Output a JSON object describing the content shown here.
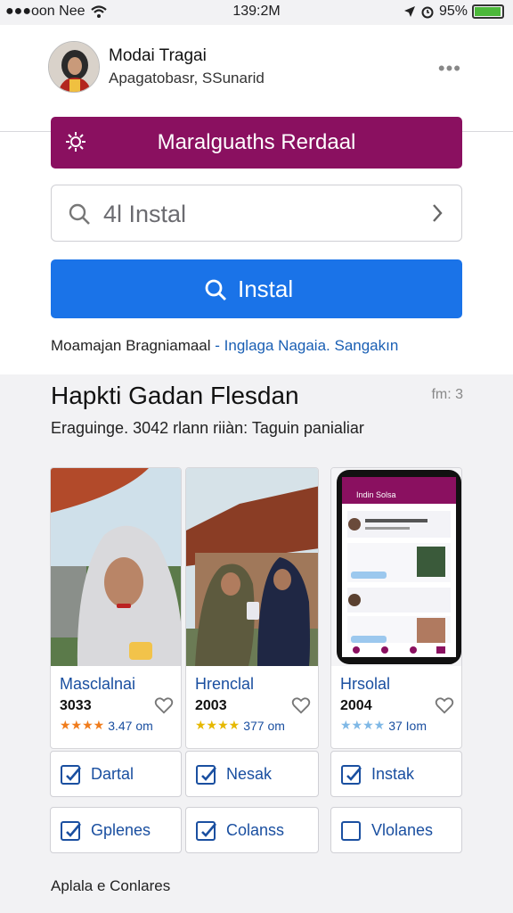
{
  "status_bar": {
    "carrier": "●●●oon Nee",
    "time": "139:2M",
    "battery": "95%",
    "battery_level": 0.95
  },
  "profile": {
    "name": "Modai Tragai",
    "subtitle": "Apagatobasr, SSunarid"
  },
  "banner": {
    "label": "Maralguaths Rerdaal"
  },
  "search": {
    "value": "4l Instal"
  },
  "install_button": {
    "label": "Instal"
  },
  "breadcrumb": {
    "main": "Mоamajan Bragniamaal",
    "link": "- Inglaga Nagaia. Sangakın"
  },
  "section": {
    "title": "Hapkti Gadan Flesdan",
    "count": "fm: 3",
    "subtitle": "Eraguinge. 3042 rlann riiàn: Taguin panialiar"
  },
  "cards": [
    {
      "title": "Masclalnai",
      "year": "3033",
      "rating": "3.47 om",
      "star_color": "#f07c1c"
    },
    {
      "title": "Hrenclal",
      "year": "2003",
      "rating": "377 om",
      "star_color": "#e6b800"
    },
    {
      "title": "Hrsolal",
      "year": "2004",
      "rating": "37 Iom",
      "star_color": "#7fb8e6"
    }
  ],
  "phone_screen": {
    "header": "Indin Solsa"
  },
  "chips_row1": [
    {
      "label": "Dartal",
      "checked": true
    },
    {
      "label": "Nesak",
      "checked": true
    },
    {
      "label": "Instak",
      "checked": true
    }
  ],
  "chips_row2": [
    {
      "label": "Gplenes",
      "checked": true
    },
    {
      "label": "Colanss",
      "checked": true
    },
    {
      "label": "Vlolanes",
      "checked": false
    }
  ],
  "footer": {
    "label": "Aplala e Conlares"
  },
  "colors": {
    "banner": "#8a1060",
    "primary_button": "#1a73e8",
    "link": "#1a4fa0"
  }
}
